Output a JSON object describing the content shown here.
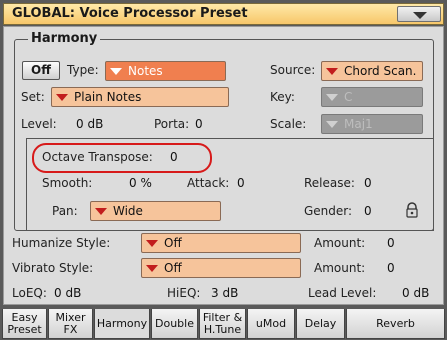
{
  "window": {
    "title": "GLOBAL: Voice Processor Preset"
  },
  "harmony": {
    "group_title": "Harmony",
    "off_button": "Off",
    "type_label": "Type:",
    "type_value": "Notes",
    "source_label": "Source:",
    "source_value": "Chord Scan.",
    "set_label": "Set:",
    "set_value": "Plain Notes",
    "key_label": "Key:",
    "key_value": "C",
    "level_label": "Level:",
    "level_value": "0 dB",
    "porta_label": "Porta:",
    "porta_value": "0",
    "scale_label": "Scale:",
    "scale_value": "Maj1",
    "octave_label": "Octave Transpose:",
    "octave_value": "0",
    "smooth_label": "Smooth:",
    "smooth_value": "0 %",
    "attack_label": "Attack:",
    "attack_value": "0",
    "release_label": "Release:",
    "release_value": "0",
    "pan_label": "Pan:",
    "pan_value": "Wide",
    "gender_label": "Gender:",
    "gender_value": "0"
  },
  "humanize": {
    "label": "Humanize Style:",
    "value": "Off",
    "amount_label": "Amount:",
    "amount_value": "0"
  },
  "vibrato": {
    "label": "Vibrato Style:",
    "value": "Off",
    "amount_label": "Amount:",
    "amount_value": "0"
  },
  "eq": {
    "loeq_label": "LoEQ:",
    "loeq_value": "0 dB",
    "hieq_label": "HiEQ:",
    "hieq_value": "3 dB",
    "lead_label": "Lead Level:",
    "lead_value": "0 dB"
  },
  "tabs": [
    {
      "line1": "Easy",
      "line2": "Preset",
      "active": false
    },
    {
      "line1": "Mixer",
      "line2": "FX",
      "active": false
    },
    {
      "line1": "Harmony",
      "line2": "",
      "active": true
    },
    {
      "line1": "Double",
      "line2": "",
      "active": false
    },
    {
      "line1": "Filter &",
      "line2": "H.Tune",
      "active": false
    },
    {
      "line1": "uMod",
      "line2": "",
      "active": false
    },
    {
      "line1": "Delay",
      "line2": "",
      "active": false
    },
    {
      "line1": "Reverb",
      "line2": "",
      "active": false
    }
  ],
  "colors": {
    "title_bar": "#f7c76a",
    "dropdown": "#f6c49b",
    "type_dropdown": "#f07f4f",
    "highlight_ring": "#d71a1a",
    "panel": "#dcdcdc"
  },
  "icons": {
    "menu": "chevron-down-icon",
    "dropdown": "dropdown-arrow-icon",
    "gender": "lock-icon"
  }
}
